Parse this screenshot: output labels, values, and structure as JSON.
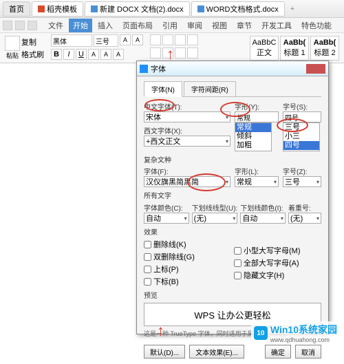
{
  "tabs": {
    "home": "首页",
    "t1": "稻壳模板",
    "t2": "新建 DOCX 文档(2).docx",
    "t3": "WORD文档格式.docx"
  },
  "menu": {
    "file": "文件",
    "start": "开始",
    "insert": "插入",
    "page": "页面布局",
    "ref": "引用",
    "review": "审阅",
    "view": "视图",
    "sect": "章节",
    "dev": "开发工具",
    "special": "特色功能"
  },
  "ribbon": {
    "paste": "粘贴",
    "copy": "复制",
    "fmt": "格式刷",
    "font": "黑体",
    "size": "三号",
    "styles": {
      "s1": {
        "sample": "AaBbC",
        "name": "正文"
      },
      "s2": {
        "sample": "AaBb(",
        "name": "标题 1"
      },
      "s3": {
        "sample": "AaBb(",
        "name": "标题 2"
      }
    }
  },
  "dlg": {
    "title": "字体",
    "tab1": "字体(N)",
    "tab2": "字符间距(R)",
    "lbl_cfont": "中文字体(T):",
    "lbl_style": "字形(Y):",
    "lbl_size": "字号(S):",
    "cfont": "宋体",
    "style": "常规",
    "size": "四号",
    "style_opts": [
      "常规",
      "倾斜",
      "加粗"
    ],
    "size_opts": [
      "三号",
      "小三",
      "四号"
    ],
    "lbl_wfont": "西文字体(X):",
    "wfont": "+西文正文",
    "sec_complex": "复杂文种",
    "lbl_font2": "字体(F):",
    "lbl_style2": "字形(L):",
    "lbl_size2": "字号(Z):",
    "font2": "汉仪旗黑简黑简",
    "style2": "常规",
    "size2": "三号",
    "sec_all": "所有文字",
    "lbl_color": "字体颜色(C):",
    "lbl_uline": "下划线线型(U):",
    "lbl_ucolor": "下划线颜色(I):",
    "lbl_emph": "着重号:",
    "color": "自动",
    "uline": "(无)",
    "ucolor": "自动",
    "emph": "(无)",
    "sec_fx": "效果",
    "c1": "删除线(K)",
    "c2": "双删除线(G)",
    "c3": "上标(P)",
    "c4": "下标(B)",
    "c5": "小型大写字母(M)",
    "c6": "全部大写字母(A)",
    "c7": "隐藏文字(H)",
    "sec_prev": "预览",
    "preview": "WPS 让办公更轻松",
    "hint": "这是一种 TrueType 字体，同时适用于屏幕和打印机。",
    "btn_def": "默认(D)...",
    "btn_fx": "文本效果(E)...",
    "btn_ok": "确定",
    "btn_cancel": "取消"
  },
  "wm": {
    "brand": "Win10系统家园",
    "url": "www.qdhuahong.com"
  }
}
